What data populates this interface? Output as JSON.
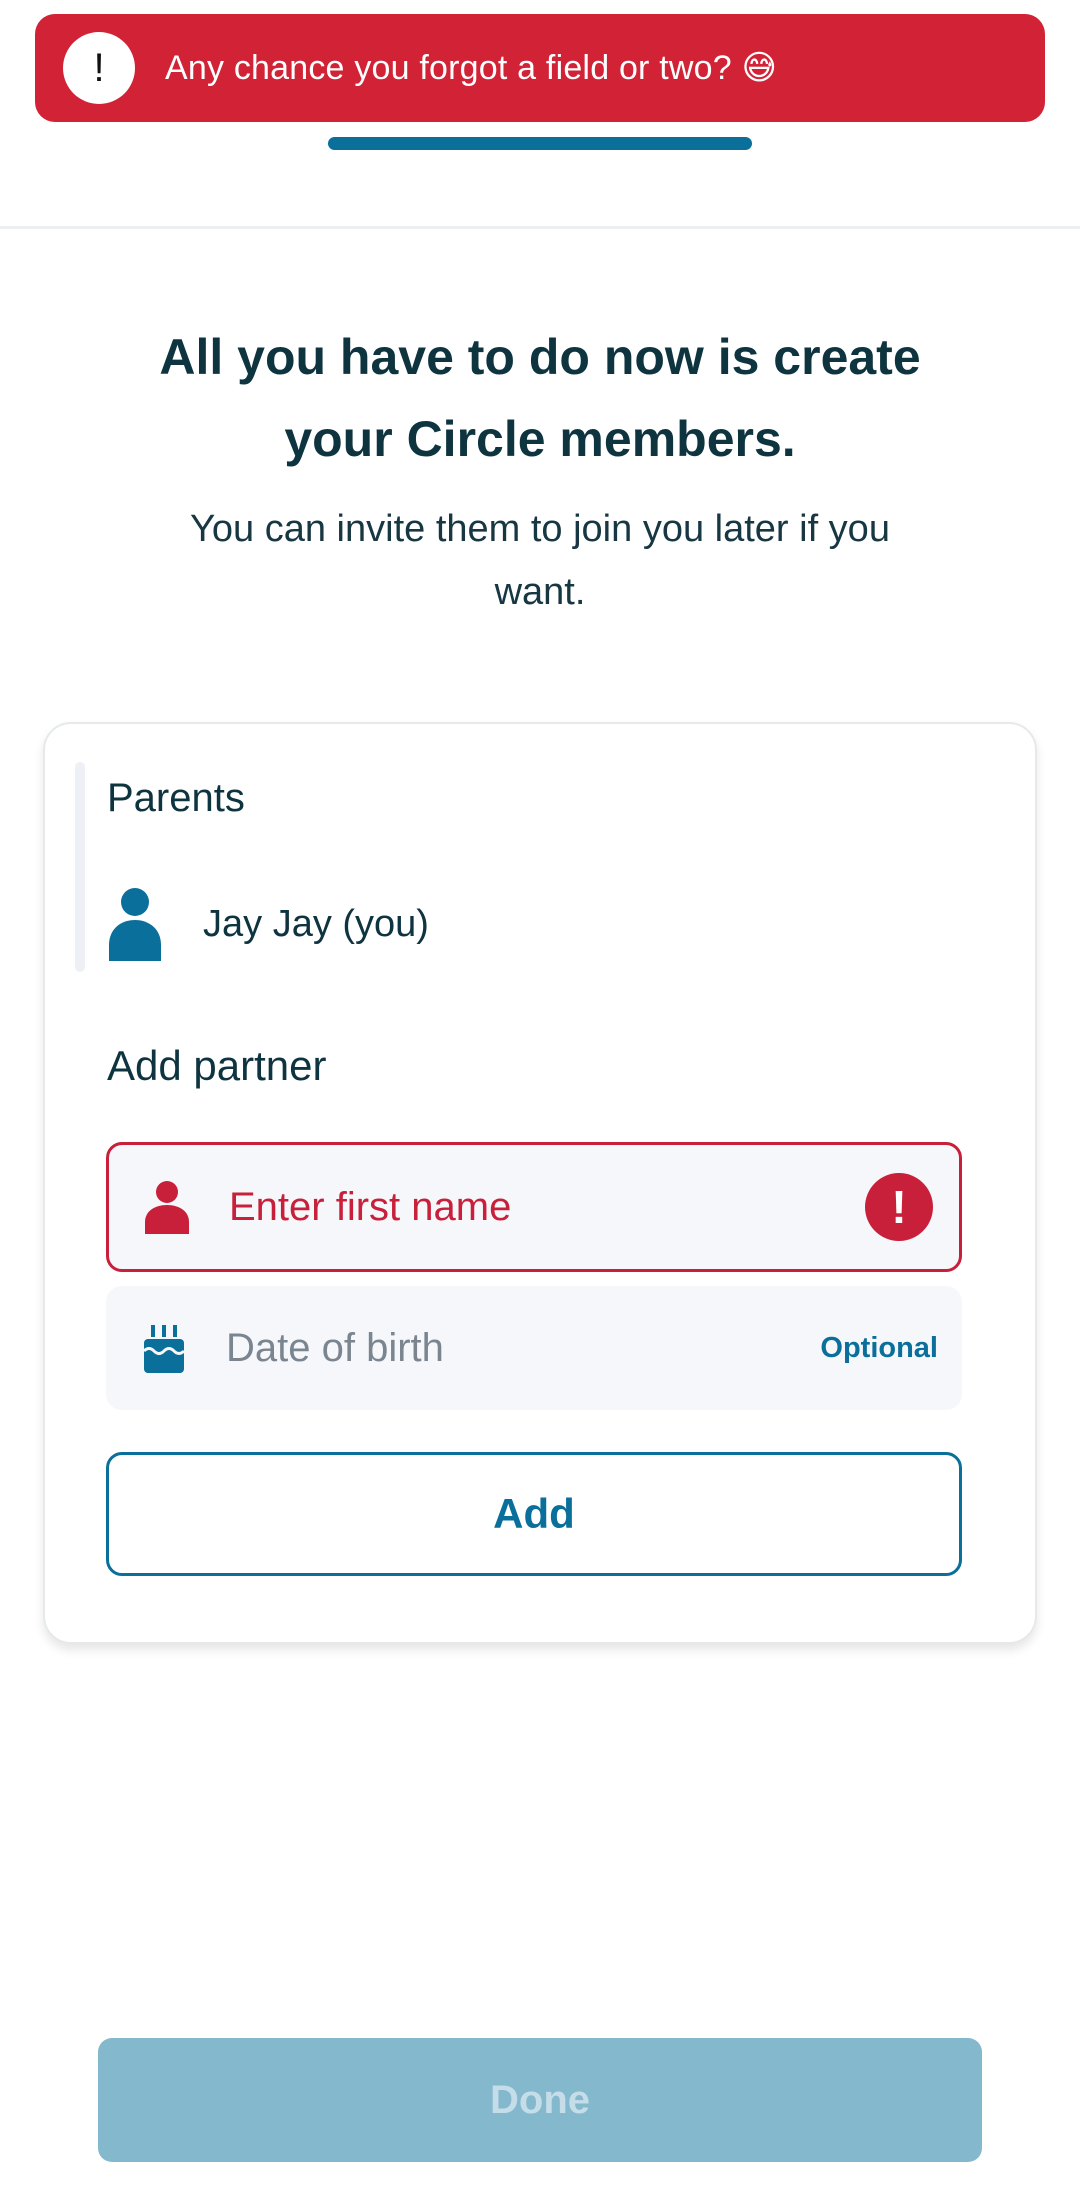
{
  "toast": {
    "icon": "exclamation-icon",
    "badge_glyph": "!",
    "message": "Any chance you forgot a field or two? 😅"
  },
  "progress": {
    "value": 1.0
  },
  "heading": {
    "title": "All you have to do now is create your Circle members.",
    "subtitle": "You can invite them to join you later if you want."
  },
  "card": {
    "parents_label": "Parents",
    "parent": {
      "name": "Jay Jay (you)",
      "icon": "person-icon"
    },
    "add_partner_label": "Add partner",
    "first_name_field": {
      "placeholder": "Enter first name",
      "icon": "person-icon",
      "error_icon": "error-icon",
      "error_glyph": "!"
    },
    "dob_field": {
      "placeholder": "Date of birth",
      "icon": "birthday-cake-icon",
      "optional_label": "Optional"
    },
    "add_button": "Add"
  },
  "done_button": "Done",
  "colors": {
    "error": "#d12236",
    "primary": "#0a6f9a",
    "disabled_button": "#83b8cd",
    "text": "#0e3440"
  }
}
